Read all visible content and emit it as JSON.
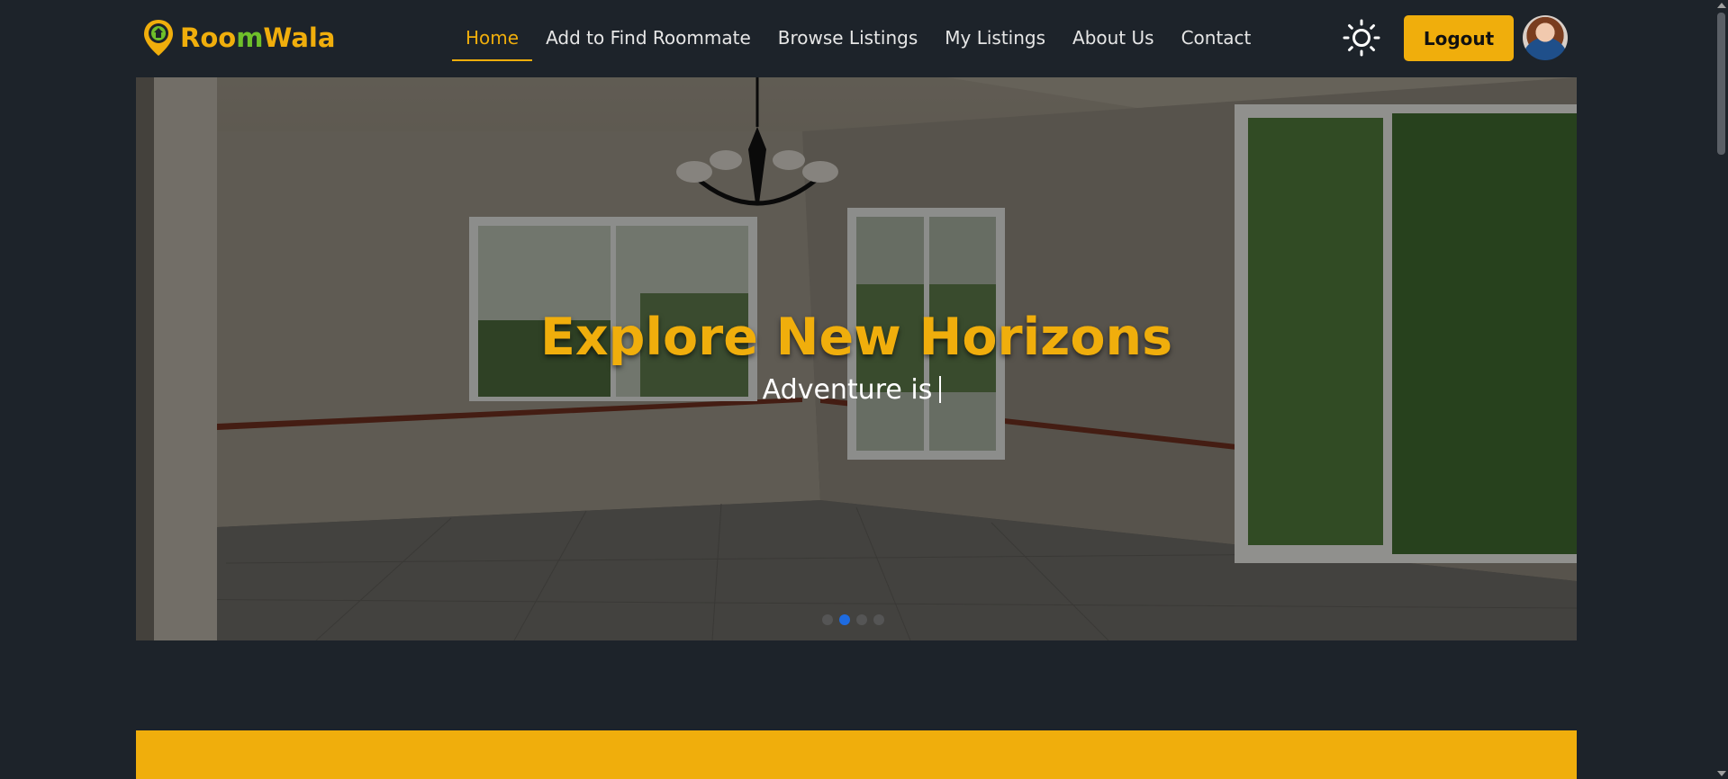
{
  "brand": {
    "part1": "Roo",
    "part2": "m",
    "part3": "Wala",
    "primary_color": "#f0ae0c",
    "accent_color": "#6fbf2a"
  },
  "nav": {
    "items": [
      {
        "label": "Home",
        "active": true
      },
      {
        "label": "Add to Find Roommate",
        "active": false
      },
      {
        "label": "Browse Listings",
        "active": false
      },
      {
        "label": "My Listings",
        "active": false
      },
      {
        "label": "About Us",
        "active": false
      },
      {
        "label": "Contact",
        "active": false
      }
    ]
  },
  "header": {
    "theme_icon": "sun-icon",
    "logout_label": "Logout",
    "avatar": "user-avatar"
  },
  "hero": {
    "title": "Explore New Horizons",
    "subtitle": "Adventure is",
    "slides": 4,
    "active_slide": 2,
    "dot_active_color": "#1e6be0"
  },
  "banner": {
    "color": "#f0ae0c"
  }
}
